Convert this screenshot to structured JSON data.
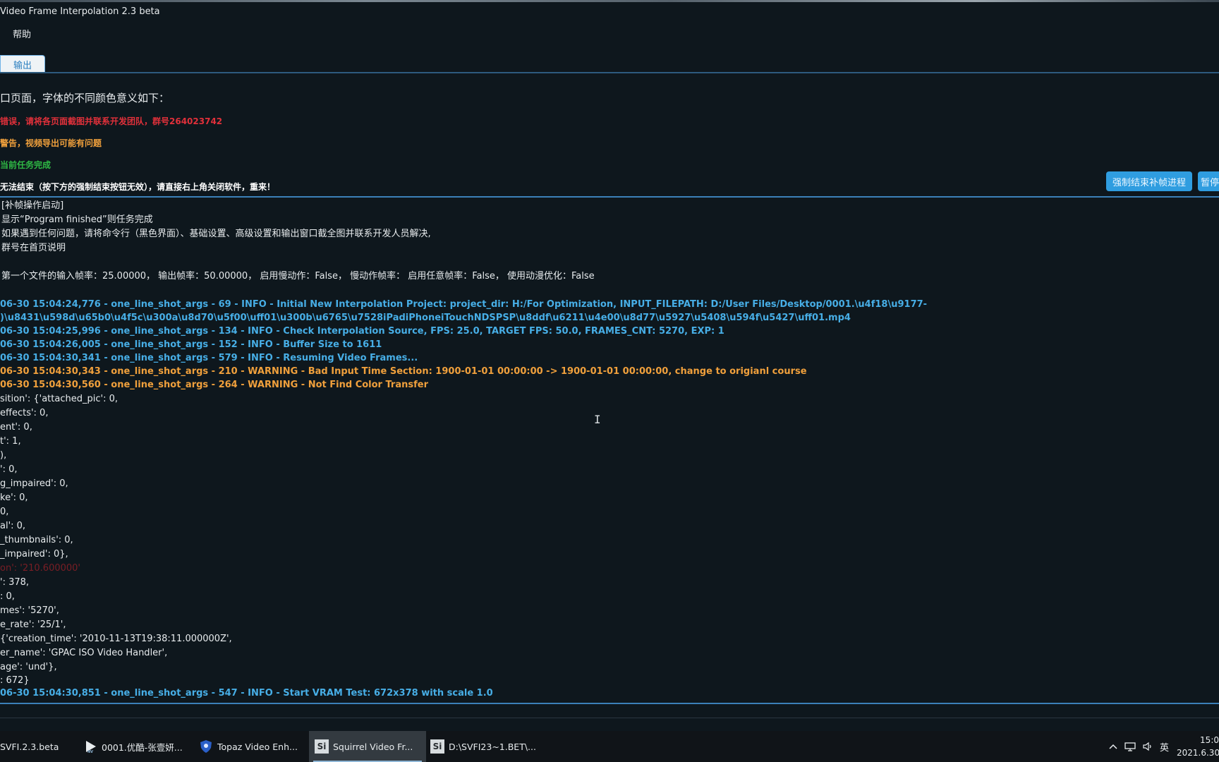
{
  "window": {
    "title": "Video Frame Interpolation 2.3 beta"
  },
  "menu": {
    "help": "帮助"
  },
  "tabs": [
    {
      "label": "输出"
    }
  ],
  "legend": {
    "title": "口页面，字体的不同颜色意义如下：",
    "error": "错误，请将各页面截图并联系开发团队，群号264023742",
    "warning": "警告，视频导出可能有问题",
    "success": "当前任务完成",
    "note": "无法结束（按下方的强制结束按钮无效），请直接右上角关闭软件，重来！",
    "colors": {
      "error": "#e0303a",
      "warning": "#f0a03c",
      "success": "#2fba45"
    }
  },
  "buttons": {
    "force_stop": "强制结束补帧进程",
    "pause": "暂停"
  },
  "log": [
    {
      "text": "[补帧操作启动]",
      "style": "plain"
    },
    {
      "text": "显示“Program finished”则任务完成",
      "style": "plain"
    },
    {
      "text": "如果遇到任何问题，请将命令行（黑色界面）、基础设置、高级设置和输出窗口截全图并联系开发人员解决,",
      "style": "plain"
    },
    {
      "text": "群号在首页说明",
      "style": "plain"
    },
    {
      "text": "",
      "style": "plain"
    },
    {
      "text": "第一个文件的输入帧率：25.00000， 输出帧率：50.00000， 启用慢动作：False， 慢动作帧率： 启用任意帧率：False， 使用动漫优化：False",
      "style": "plain"
    },
    {
      "text": "",
      "style": "plain"
    },
    {
      "text": "06-30 15:04:24,776 - one_line_shot_args - 69 - INFO - Initial New Interpolation Project: project_dir: H:/For Optimization, INPUT_FILEPATH: D:/User Files/Desktop/0001.\\u4f18\\u9177-",
      "style": "info"
    },
    {
      "text": ")\\u8431\\u598d\\u65b0\\u4f5c\\u300a\\u8d70\\u5f00\\uff01\\u300b\\u6765\\u7528iPadiPhoneiTouchNDSPSP\\u8ddf\\u6211\\u4e00\\u8d77\\u5927\\u5408\\u594f\\u5427\\uff01.mp4",
      "style": "info"
    },
    {
      "text": "06-30 15:04:25,996 - one_line_shot_args - 134 - INFO - Check Interpolation Source, FPS: 25.0, TARGET FPS: 50.0, FRAMES_CNT: 5270, EXP: 1",
      "style": "info"
    },
    {
      "text": "06-30 15:04:26,005 - one_line_shot_args - 152 - INFO - Buffer Size to 1611",
      "style": "info"
    },
    {
      "text": "06-30 15:04:30,341 - one_line_shot_args - 579 - INFO - Resuming Video Frames...",
      "style": "info"
    },
    {
      "text": "06-30 15:04:30,343 - one_line_shot_args - 210 - WARNING - Bad Input Time Section: 1900-01-01 00:00:00 -> 1900-01-01 00:00:00, change to origianl course",
      "style": "warn"
    },
    {
      "text": "06-30 15:04:30,560 - one_line_shot_args - 264 - WARNING - Not Find Color Transfer",
      "style": "warn"
    },
    {
      "text": "sition': {'attached_pic': 0,",
      "style": "plain"
    },
    {
      "text": "effects': 0,",
      "style": "plain"
    },
    {
      "text": "ent': 0,",
      "style": "plain"
    },
    {
      "text": "t': 1,",
      "style": "plain"
    },
    {
      "text": "),",
      "style": "plain"
    },
    {
      "text": "': 0,",
      "style": "plain"
    },
    {
      "text": "g_impaired': 0,",
      "style": "plain"
    },
    {
      "text": "ke': 0,",
      "style": "plain"
    },
    {
      "text": "0,",
      "style": "plain"
    },
    {
      "text": "al': 0,",
      "style": "plain"
    },
    {
      "text": "_thumbnails': 0,",
      "style": "plain"
    },
    {
      "text": "_impaired': 0},",
      "style": "plain"
    },
    {
      "text": "on': '210.600000'",
      "style": "red"
    },
    {
      "text": "': 378,",
      "style": "plain"
    },
    {
      "text": ": 0,",
      "style": "plain"
    },
    {
      "text": "mes': '5270',",
      "style": "plain"
    },
    {
      "text": "e_rate': '25/1',",
      "style": "plain"
    },
    {
      "text": "{'creation_time': '2010-11-13T19:38:11.000000Z',",
      "style": "plain"
    },
    {
      "text": "er_name': 'GPAC ISO Video Handler',",
      "style": "plain"
    },
    {
      "text": "age': 'und'},",
      "style": "plain"
    },
    {
      "text": ": 672}",
      "style": "plain"
    },
    {
      "text": "06-30 15:04:30,851 - one_line_shot_args - 547 - INFO - Start VRAM Test: 672x378 with scale 1.0",
      "style": "info"
    }
  ],
  "taskbar": {
    "items": [
      {
        "label": "SVFI.2.3.beta",
        "icon": "app-icon"
      },
      {
        "label": "0001.优酷-张壹妍...",
        "icon": "play-icon"
      },
      {
        "label": "Topaz Video Enh...",
        "icon": "shield-icon"
      },
      {
        "label": "Squirrel Video Fr...",
        "icon": "si-icon",
        "active": true
      },
      {
        "label": "D:\\SVFI23~1.BET\\...",
        "icon": "si-icon"
      }
    ],
    "tray": {
      "ime": "英"
    },
    "clock": {
      "time": "15:0",
      "date": "2021.6.30"
    }
  }
}
